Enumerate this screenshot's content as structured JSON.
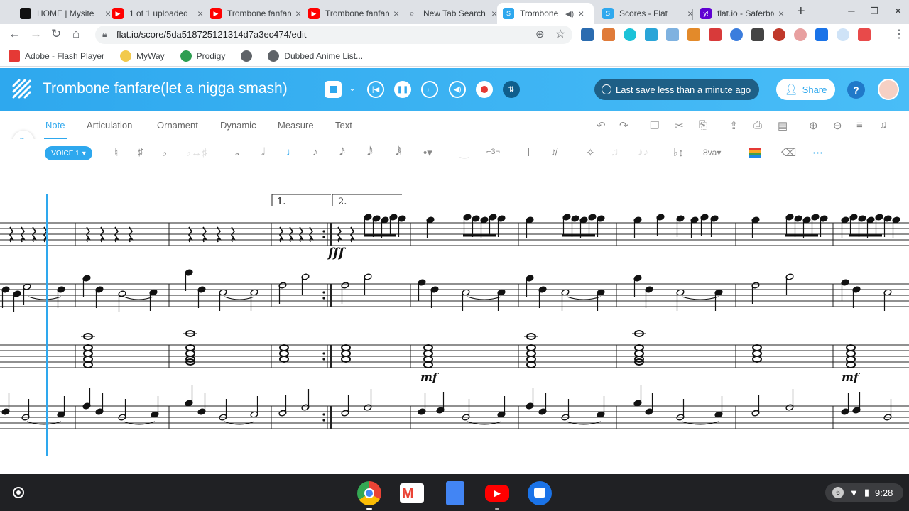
{
  "browser": {
    "tabs": [
      {
        "title": "HOME | Mysite",
        "icon": "wix-icon",
        "color": "#111111"
      },
      {
        "title": "1 of 1 uploaded",
        "icon": "youtube-icon",
        "color": "#ff0000"
      },
      {
        "title": "Trombone fanfare",
        "icon": "youtube-icon",
        "color": "#ff0000"
      },
      {
        "title": "Trombone fanfare",
        "icon": "youtube-icon",
        "color": "#ff0000"
      },
      {
        "title": "New Tab Search",
        "icon": "search-icon",
        "color": "#5f6368"
      },
      {
        "title": "Trombone",
        "icon": "flat-icon",
        "color": "#2ea8ee",
        "active": true
      },
      {
        "title": "Scores - Flat",
        "icon": "flat-icon",
        "color": "#2ea8ee"
      },
      {
        "title": "flat.io - Saferbrowser",
        "icon": "yahoo-icon",
        "color": "#6001d2"
      }
    ],
    "url": "flat.io/score/5da518725121314d7a3ec474/edit",
    "bookmarks": [
      "Adobe - Flash Player",
      "MyWay",
      "Prodigy",
      "Dubbed Anime List..."
    ]
  },
  "flat": {
    "title": "Trombone fanfare(let a nigga smash)",
    "save_status": "Last save less than a minute ago",
    "share_label": "Share",
    "help_label": "?",
    "editor_tabs": [
      "Note",
      "Articulation",
      "Ornament",
      "Dynamic",
      "Measure",
      "Text"
    ],
    "active_tab": "Note",
    "voice_label": "VOICE 1",
    "accent": "#2ea8ee",
    "score": {
      "volta_1": "1.",
      "volta_2": "2.",
      "dynamic_fff": "fff",
      "dynamic_mf": "mf"
    }
  },
  "shelf": {
    "apps": [
      "chrome-icon",
      "gmail-icon",
      "docs-icon",
      "youtube-icon",
      "messages-icon"
    ],
    "notification_count": "6",
    "time": "9:28"
  }
}
